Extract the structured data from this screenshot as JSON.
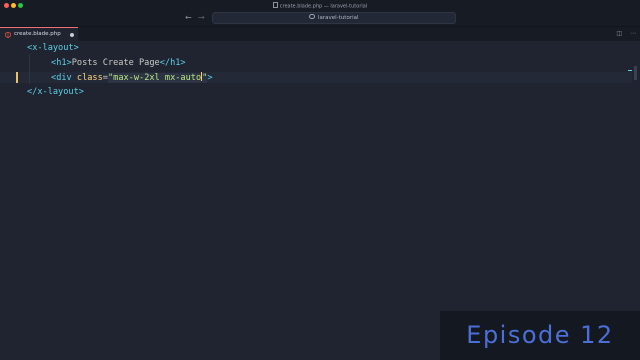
{
  "window": {
    "title": "create.blade.php — laravel-tutorial"
  },
  "toolbar": {
    "back_icon": "arrow-left-icon",
    "forward_icon": "arrow-right-icon",
    "search_text": "laravel-tutorial"
  },
  "tabs": [
    {
      "label": "create.blade.php",
      "icon": "laravel-icon",
      "modified": true
    }
  ],
  "editor": {
    "lines": [
      {
        "open": "<",
        "tag": "x-layout",
        "close": ">"
      },
      {
        "open1": "<",
        "tag1": "h1",
        "close1": ">",
        "text": "Posts Create Page",
        "open2": "</",
        "tag2": "h1",
        "close2": ">"
      },
      {
        "open": "<",
        "tag": "div",
        "attr": "class",
        "eq": "=",
        "quote_open": "\"",
        "value": "max-w-2xl mx-auto",
        "quote_close": "\"",
        "close": ">"
      },
      {
        "open": "</",
        "tag": "x-layout",
        "close": ">"
      }
    ]
  },
  "watermark": {
    "text": "Episode 12"
  },
  "colors": {
    "background": "#1f2430",
    "tag": "#5ccfe6",
    "attribute": "#ffd580",
    "string": "#bae67e",
    "episode": "#4b6fd6"
  }
}
